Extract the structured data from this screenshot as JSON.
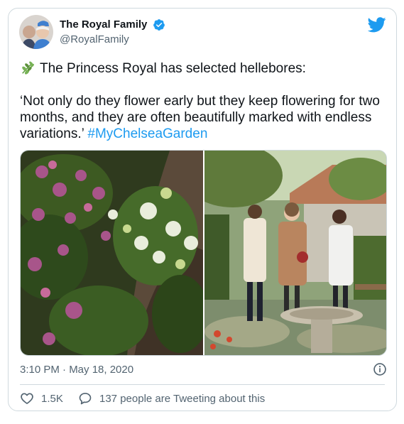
{
  "tweet": {
    "author": {
      "display_name": "The Royal Family",
      "handle": "@RoyalFamily",
      "verified": true,
      "avatar_icon": "avatar-photo"
    },
    "platform_icon": "twitter-bird-icon",
    "text_line1": "The Princess Royal has selected hellebores:",
    "quote": "‘Not only do they flower early but they keep flowering for two months, and they are often beautifully marked with endless variations.’",
    "hashtag": "#MyChelseaGarden",
    "timestamp": "3:10 PM · May 18, 2020",
    "likes": "1.5K",
    "replies_text": "137 people are Tweeting about this"
  },
  "colors": {
    "accent": "#1d9bf0",
    "secondary_text": "#536471",
    "border": "#cfd9de",
    "primary_text": "#0f1419"
  }
}
